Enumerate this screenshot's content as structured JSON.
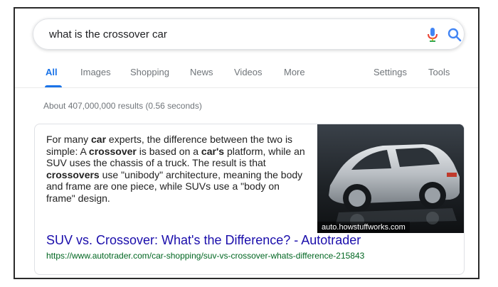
{
  "search": {
    "query": "what is the crossover car",
    "mic_icon": "microphone-icon",
    "search_icon": "magnifier-icon"
  },
  "tabs": [
    {
      "label": "All",
      "active": true
    },
    {
      "label": "Images"
    },
    {
      "label": "Shopping"
    },
    {
      "label": "News"
    },
    {
      "label": "Videos"
    },
    {
      "label": "More"
    },
    {
      "label": "Settings"
    },
    {
      "label": "Tools"
    }
  ],
  "stats": "About 407,000,000 results (0.56 seconds)",
  "snippet": {
    "parts": [
      {
        "t": "For many "
      },
      {
        "t": "car",
        "b": true
      },
      {
        "t": " experts, the difference between the two is simple: A "
      },
      {
        "t": "crossover",
        "b": true
      },
      {
        "t": " is based on a "
      },
      {
        "t": "car's",
        "b": true
      },
      {
        "t": " platform, while an SUV uses the chassis of a truck. The result is that "
      },
      {
        "t": "crossovers",
        "b": true
      },
      {
        "t": " use \"unibody\" architecture, meaning the body and frame are one piece, while SUVs use a \"body on frame\" design."
      }
    ],
    "image_caption": "auto.howstuffworks.com",
    "result_title": "SUV vs. Crossover: What's the Difference? - Autotrader",
    "result_url": "https://www.autotrader.com/car-shopping/suv-vs-crossover-whats-difference-215843"
  },
  "colors": {
    "link": "#1a0dab",
    "url": "#006621",
    "accent": "#1a73e8",
    "muted": "#70757a"
  }
}
